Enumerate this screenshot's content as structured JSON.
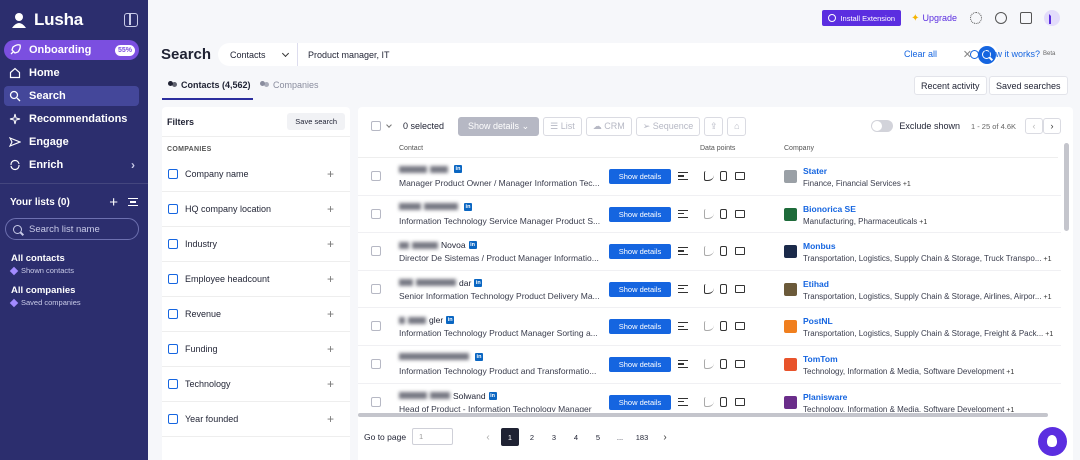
{
  "brand": {
    "name": "Lusha"
  },
  "sidebar": {
    "onboarding": {
      "label": "Onboarding",
      "badge": "55%"
    },
    "items": [
      {
        "label": "Home"
      },
      {
        "label": "Search"
      },
      {
        "label": "Recommendations"
      },
      {
        "label": "Engage"
      },
      {
        "label": "Enrich"
      }
    ],
    "lists_title": "Your lists (0)",
    "list_search_placeholder": "Search list name",
    "all_contacts": {
      "title": "All contacts",
      "sub": "Shown contacts"
    },
    "all_companies": {
      "title": "All companies",
      "sub": "Saved companies"
    }
  },
  "topbar": {
    "install_label": "Install Extension",
    "upgrade_label": "Upgrade"
  },
  "search": {
    "title": "Search",
    "type": "Contacts",
    "query": "Product manager, IT",
    "clear_all": "Clear all",
    "how_works": "How it works?",
    "beta": "Beta"
  },
  "tabs": {
    "contacts": "Contacts (4,562)",
    "companies": "Companies",
    "recent_activity": "Recent activity",
    "saved_searches": "Saved searches"
  },
  "filters": {
    "title": "Filters",
    "save_search": "Save search",
    "section": "COMPANIES",
    "items": [
      {
        "label": "Company name"
      },
      {
        "label": "HQ company location"
      },
      {
        "label": "Industry"
      },
      {
        "label": "Employee headcount"
      },
      {
        "label": "Revenue"
      },
      {
        "label": "Funding"
      },
      {
        "label": "Technology"
      },
      {
        "label": "Year founded"
      }
    ]
  },
  "results": {
    "selected": "0 selected",
    "show_details": "Show details",
    "list": "List",
    "crm": "CRM",
    "sequence": "Sequence",
    "exclude_shown": "Exclude shown",
    "range": "1 - 25 of 4.6K",
    "col_contact": "Contact",
    "col_data_points": "Data points",
    "col_company": "Company",
    "row_button": "Show details",
    "rows": [
      {
        "name_tail": "",
        "title": "Manager Product Owner / Manager Information Tec...",
        "company": "Stater",
        "industry": "Finance, Financial Services",
        "more": "+1",
        "logo_color": "#9aa0a6",
        "faded": false
      },
      {
        "name_tail": "",
        "title": "Information Technology Service Manager Product S...",
        "company": "Bionorica SE",
        "industry": "Manufacturing, Pharmaceuticals",
        "more": "+1",
        "logo_color": "#1e6b3a",
        "faded": true
      },
      {
        "name_tail": "Novoa",
        "title": "Director De Sistemas / Product Manager Informatio...",
        "company": "Monbus",
        "industry": "Transportation, Logistics, Supply Chain & Storage, Truck Transpo...",
        "more": "+1",
        "logo_color": "#1b2a4a",
        "faded": true
      },
      {
        "name_tail": "dar",
        "title": "Senior Information Technology Product Delivery Ma...",
        "company": "Etihad",
        "industry": "Transportation, Logistics, Supply Chain & Storage, Airlines, Airpor...",
        "more": "+1",
        "logo_color": "#6b5a3a",
        "faded": false
      },
      {
        "name_tail": "gler",
        "title": "Information Technology Product Manager Sorting a...",
        "company": "PostNL",
        "industry": "Transportation, Logistics, Supply Chain & Storage, Freight & Pack...",
        "more": "+1",
        "logo_color": "#f07f1e",
        "faded": true
      },
      {
        "name_tail": "",
        "title": "Information Technology Product and Transformatio...",
        "company": "TomTom",
        "industry": "Technology, Information & Media, Software Development",
        "more": "+1",
        "logo_color": "#e8532b",
        "faded": true
      },
      {
        "name_tail": "Solwand",
        "title": "Head of Product - Information Technology Manager",
        "company": "Planisware",
        "industry": "Technology, Information & Media, Software Development",
        "more": "+1",
        "logo_color": "#6a2d8a",
        "faded": true
      }
    ]
  },
  "pager": {
    "goto_label": "Go to page",
    "goto_value": "1",
    "pages": [
      "1",
      "2",
      "3",
      "4",
      "5",
      "...",
      "183"
    ]
  }
}
